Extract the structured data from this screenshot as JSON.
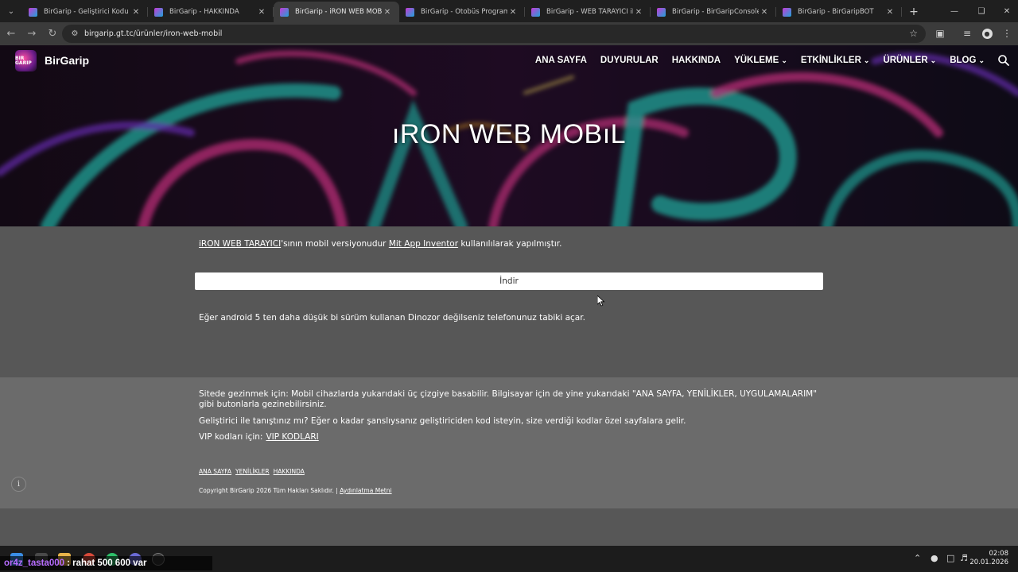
{
  "browser": {
    "tabs": [
      {
        "title": "BirGarip - Geliştirici Kodu",
        "active": false
      },
      {
        "title": "BirGarip - HAKKINDA",
        "active": false
      },
      {
        "title": "BirGarip - iRON WEB MOBİL",
        "active": true
      },
      {
        "title": "BirGarip - Otobüs Programı",
        "active": false
      },
      {
        "title": "BirGarip - WEB TARAYICI iROn",
        "active": false
      },
      {
        "title": "BirGarip - BirGaripConsole",
        "active": false
      },
      {
        "title": "BirGarip - BirGaripBOT",
        "active": false
      }
    ],
    "url": "birgarip.gt.tc/ürünler/iron-web-mobil"
  },
  "site": {
    "brand": "BirGarip",
    "logo_text": "BIR GARIP",
    "nav": [
      {
        "label": "ANA SAYFA",
        "dropdown": false
      },
      {
        "label": "DUYURULAR",
        "dropdown": false
      },
      {
        "label": "HAKKINDA",
        "dropdown": false
      },
      {
        "label": "YÜKLEME",
        "dropdown": true
      },
      {
        "label": "ETKİNLİKLER",
        "dropdown": true
      },
      {
        "label": "ÜRÜNLER",
        "dropdown": true
      },
      {
        "label": "BLOG",
        "dropdown": true
      }
    ]
  },
  "hero": {
    "title": "ıRON WEB MOBıL"
  },
  "content": {
    "intro_link1": "iRON WEB TARAYICI",
    "intro_text1": "'sının mobil versiyonudur ",
    "intro_link2": "Mit App Inventor",
    "intro_text2": " kullanılılarak yapılmıştır.",
    "download_label": "İndir",
    "note": "Eğer android 5 ten daha düşük bi sürüm kullanan Dinozor değilseniz telefonunuz tabiki açar."
  },
  "footer": {
    "nav_help": "Sitede gezinmek için: Mobil cihazlarda yukarıdaki üç çizgiye basabilir. Bilgisayar için de yine yukarıdaki \"ANA SAYFA, YENİLİKLER, UYGULAMALARIM\" gibi butonlarla gezinebilirsiniz.",
    "dev_help": "Geliştirici ile tanıştınız mı? Eğer o kadar şanslıysanız geliştiriciden kod isteyin, size verdiği kodlar özel sayfalara gelir.",
    "vip_label": "VIP kodları için:",
    "vip_link": "VIP KODLARI",
    "links": [
      "ANA SAYFA",
      "YENİLİKLER",
      "HAKKINDA"
    ],
    "copyright": "Copyright BirGarip 2026 Tüm Hakları Saklıdır.",
    "copyright_sep": "|",
    "privacy_link": "Aydınlatma Metni"
  },
  "overlay": {
    "user": "or4z_tasta000",
    "message": ": rahat 500 600 var"
  },
  "taskbar": {
    "time": "02:08",
    "date": "20.01.2026"
  },
  "colors": {
    "page_bg": "#575757",
    "footer_bg": "#6b6b6b",
    "chat_user": "#b76cff"
  }
}
